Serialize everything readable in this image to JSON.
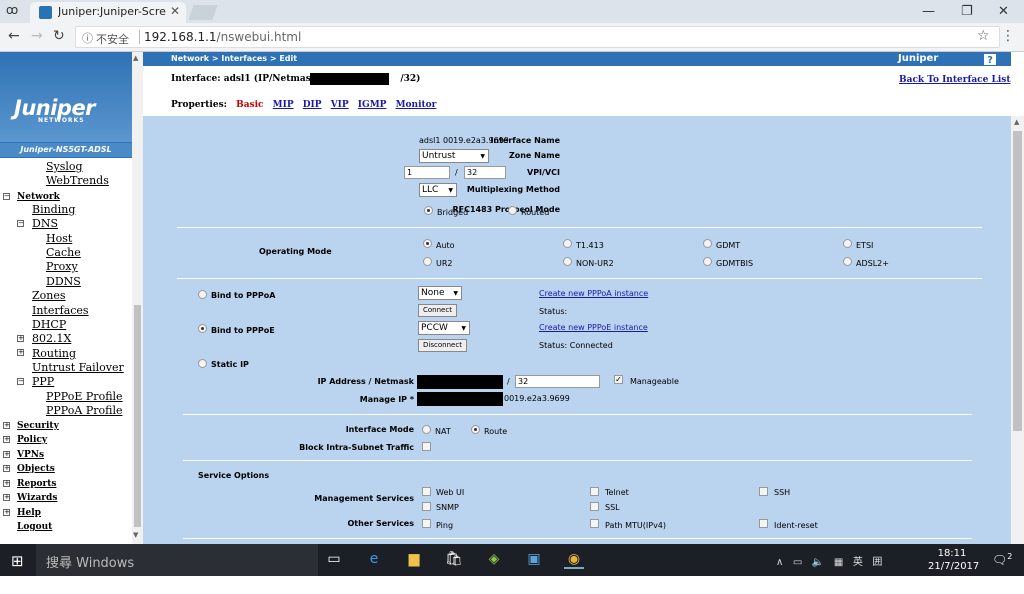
{
  "browser": {
    "tab_title": "Juniper:Juniper-Screen",
    "security": "不安全",
    "host": "192.168.1.1",
    "path": "/nswebui.html"
  },
  "sidebar": {
    "logo": "Juniper",
    "logo_sub": "NETWORKS",
    "device": "Juniper-NS5GT-ADSL",
    "items": [
      {
        "label": "Syslog"
      },
      {
        "label": "WebTrends"
      },
      {
        "label": "Network"
      },
      {
        "label": "Binding"
      },
      {
        "label": "DNS"
      },
      {
        "label": "Host"
      },
      {
        "label": "Cache"
      },
      {
        "label": "Proxy"
      },
      {
        "label": "DDNS"
      },
      {
        "label": "Zones"
      },
      {
        "label": "Interfaces"
      },
      {
        "label": "DHCP"
      },
      {
        "label": "802.1X"
      },
      {
        "label": "Routing"
      },
      {
        "label": "Untrust Failover"
      },
      {
        "label": "PPP"
      },
      {
        "label": "PPPoE Profile"
      },
      {
        "label": "PPPoA Profile"
      },
      {
        "label": "Security"
      },
      {
        "label": "Policy"
      },
      {
        "label": "VPNs"
      },
      {
        "label": "Objects"
      },
      {
        "label": "Reports"
      },
      {
        "label": "Wizards"
      },
      {
        "label": "Help"
      },
      {
        "label": "Logout"
      }
    ]
  },
  "header": {
    "breadcrumb": "Network > Interfaces > Edit",
    "brand": "Juniper",
    "help": "?",
    "if_prefix": "Interface: adsl1 (IP/Netmask:",
    "if_suffix": "/32)",
    "back_link": "Back To Interface List"
  },
  "properties": {
    "label": "Properties:",
    "tabs": [
      "Basic",
      "MIP",
      "DIP",
      "VIP",
      "IGMP",
      "Monitor"
    ]
  },
  "form": {
    "interface_name_label": "Interface Name",
    "interface_name_value": "adsl1 0019.e2a3.9699",
    "zone_label": "Zone Name",
    "zone_value": "Untrust",
    "vpivci_label": "VPI/VCI",
    "vpi": "1",
    "vci_sep": "/",
    "vci": "32",
    "mux_label": "Multiplexing Method",
    "mux_value": "LLC",
    "rfc_label": "RFC1483 Protocol Mode",
    "rfc_bridged": "Bridged",
    "rfc_routed": "Routed",
    "opmode_label": "Operating Mode",
    "opmodes": [
      "Auto",
      "T1.413",
      "GDMT",
      "ETSI",
      "UR2",
      "NON-UR2",
      "GDMTBIS",
      "ADSL2+"
    ],
    "pppoa_label": "Bind to PPPoA",
    "pppoa_value": "None",
    "pppoa_connect": "Connect",
    "pppoa_create": "Create new PPPoA instance",
    "pppoa_status": "Status:",
    "pppoe_label": "Bind to PPPoE",
    "pppoe_value": "PCCW",
    "pppoe_disconnect": "Disconnect",
    "pppoe_create": "Create new PPPoE instance",
    "pppoe_status": "Status: Connected",
    "static_label": "Static IP",
    "ipmask_label": "IP Address / Netmask",
    "mask_sep": "/",
    "mask_value": "32",
    "manageable": "Manageable",
    "manageip_label": "Manage IP *",
    "manageip_suffix": "0019.e2a3.9699",
    "ifmode_label": "Interface Mode",
    "ifmode_nat": "NAT",
    "ifmode_route": "Route",
    "block_label": "Block Intra-Subnet Traffic",
    "service_options": "Service Options",
    "mgmt_label": "Management Services",
    "mgmt": [
      "Web UI",
      "Telnet",
      "SSH",
      "SNMP",
      "SSL"
    ],
    "other_label": "Other Services",
    "other": [
      "Ping",
      "Path MTU(IPv4)",
      "Ident-reset"
    ]
  },
  "taskbar": {
    "search": "搜尋 Windows",
    "ime": "英",
    "time": "18:11",
    "date": "21/7/2017",
    "notif_count": "2"
  }
}
